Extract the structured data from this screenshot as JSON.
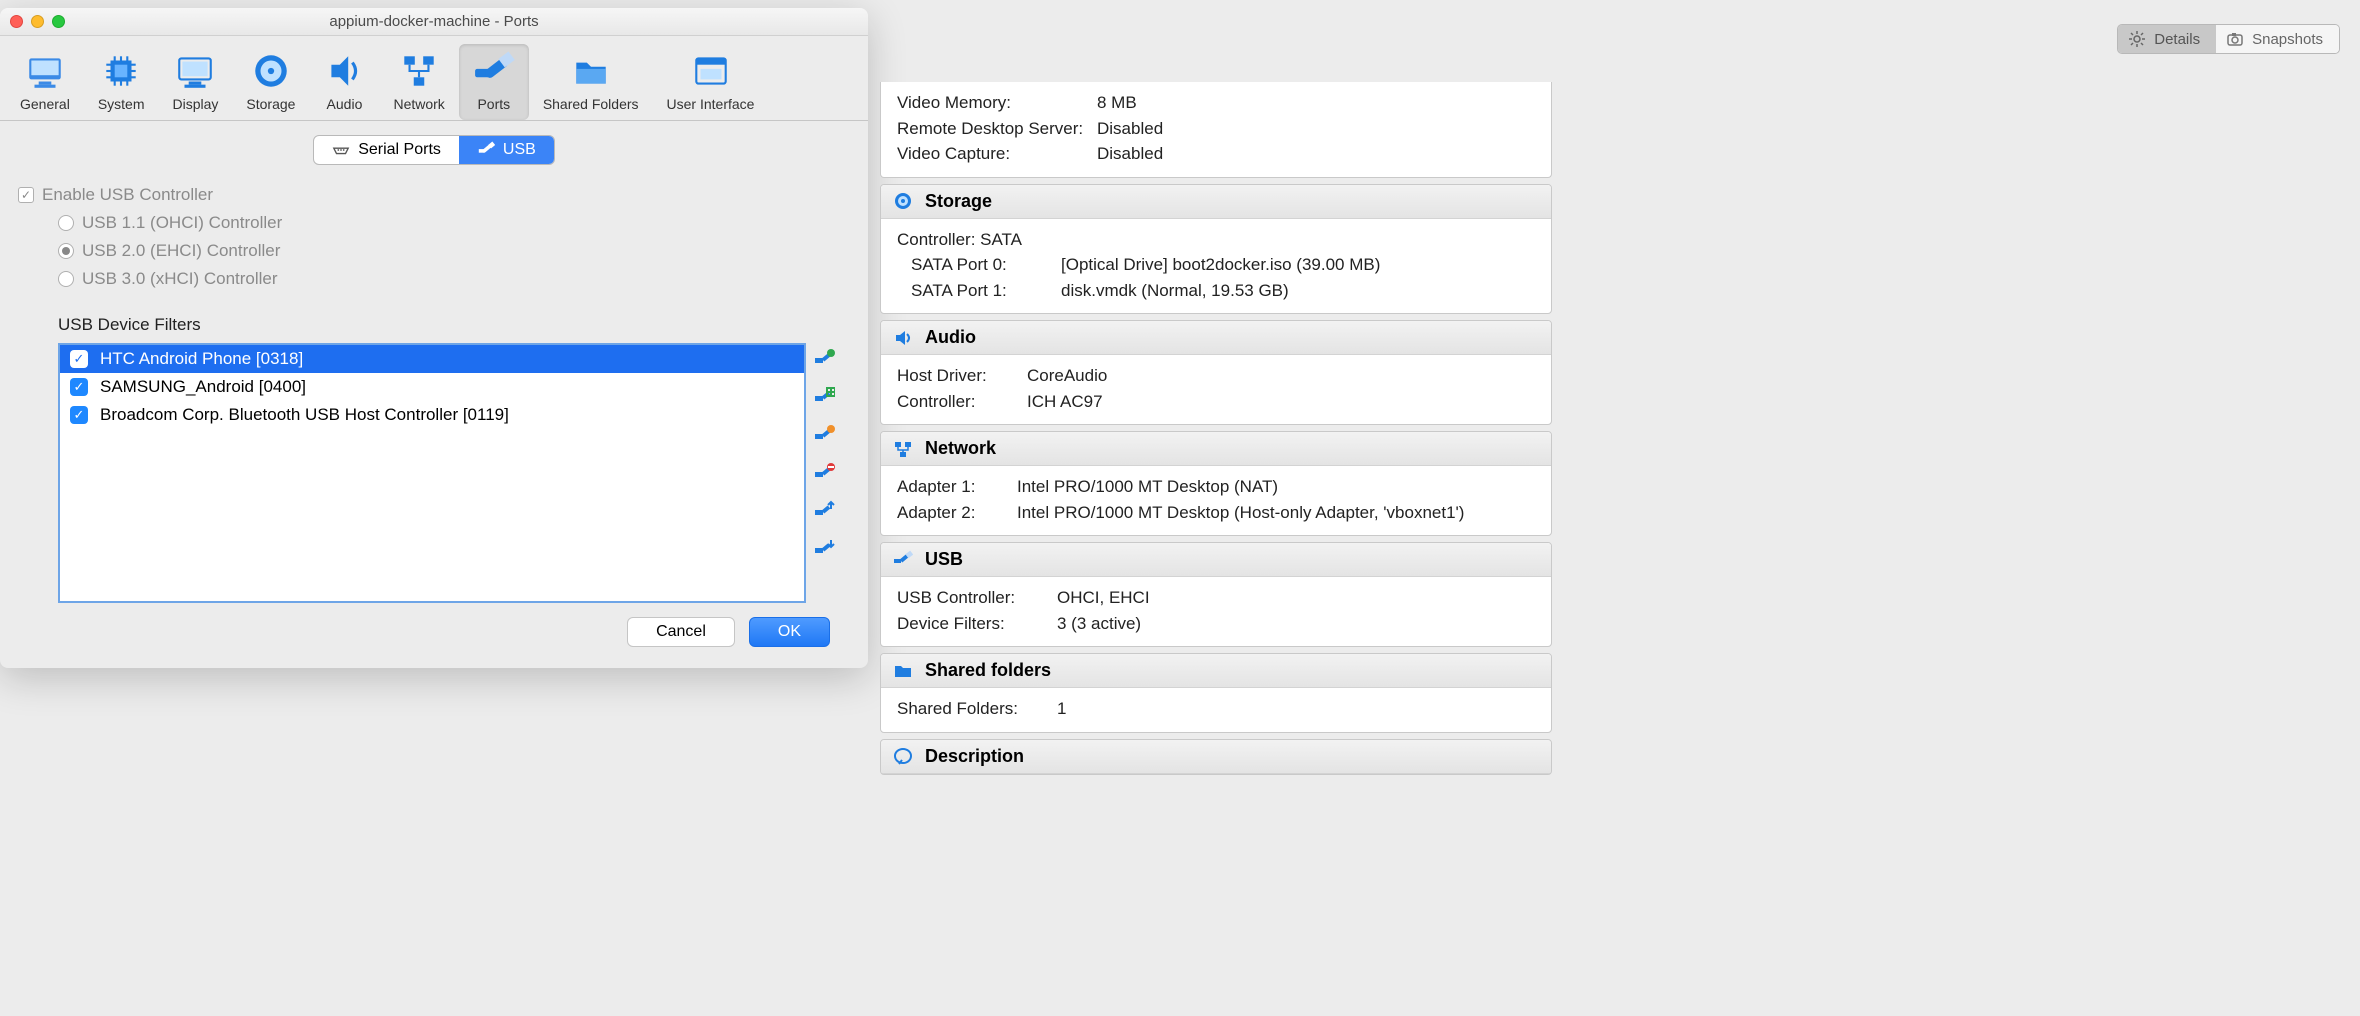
{
  "dialog": {
    "title": "appium-docker-machine - Ports",
    "toolbar": [
      {
        "id": "general",
        "label": "General"
      },
      {
        "id": "system",
        "label": "System"
      },
      {
        "id": "display",
        "label": "Display"
      },
      {
        "id": "storage",
        "label": "Storage"
      },
      {
        "id": "audio",
        "label": "Audio"
      },
      {
        "id": "network",
        "label": "Network"
      },
      {
        "id": "ports",
        "label": "Ports"
      },
      {
        "id": "shared",
        "label": "Shared Folders"
      },
      {
        "id": "ui",
        "label": "User Interface"
      }
    ],
    "tabs": {
      "serial": "Serial Ports",
      "usb": "USB"
    },
    "enable_usb": "Enable USB Controller",
    "usb11": "USB 1.1 (OHCI) Controller",
    "usb20": "USB 2.0 (EHCI) Controller",
    "usb30": "USB 3.0 (xHCI) Controller",
    "filters_label": "USB Device Filters",
    "filters": [
      {
        "name": "HTC Android Phone [0318]"
      },
      {
        "name": "SAMSUNG_Android [0400]"
      },
      {
        "name": "Broadcom Corp. Bluetooth USB Host Controller [0119]"
      }
    ],
    "cancel": "Cancel",
    "ok": "OK"
  },
  "toggle": {
    "details": "Details",
    "snapshots": "Snapshots"
  },
  "info": {
    "display_rows": [
      {
        "k": "Video Memory:",
        "v": "8 MB"
      },
      {
        "k": "Remote Desktop Server:",
        "v": "Disabled"
      },
      {
        "k": "Video Capture:",
        "v": "Disabled"
      }
    ],
    "storage_head": "Storage",
    "storage_controller": "Controller: SATA",
    "storage_rows": [
      {
        "k": "SATA Port 0:",
        "v": "[Optical Drive] boot2docker.iso (39.00 MB)"
      },
      {
        "k": "SATA Port 1:",
        "v": "disk.vmdk (Normal, 19.53 GB)"
      }
    ],
    "audio_head": "Audio",
    "audio_rows": [
      {
        "k": "Host Driver:",
        "v": "CoreAudio"
      },
      {
        "k": "Controller:",
        "v": "ICH AC97"
      }
    ],
    "network_head": "Network",
    "network_rows": [
      {
        "k": "Adapter 1:",
        "v": "Intel PRO/1000 MT Desktop (NAT)"
      },
      {
        "k": "Adapter 2:",
        "v": "Intel PRO/1000 MT Desktop (Host-only Adapter, 'vboxnet1')"
      }
    ],
    "usb_head": "USB",
    "usb_rows": [
      {
        "k": "USB Controller:",
        "v": "OHCI, EHCI"
      },
      {
        "k": "Device Filters:",
        "v": "3 (3 active)"
      }
    ],
    "sf_head": "Shared folders",
    "sf_rows": [
      {
        "k": "Shared Folders:",
        "v": "1"
      }
    ],
    "desc_head": "Description"
  }
}
